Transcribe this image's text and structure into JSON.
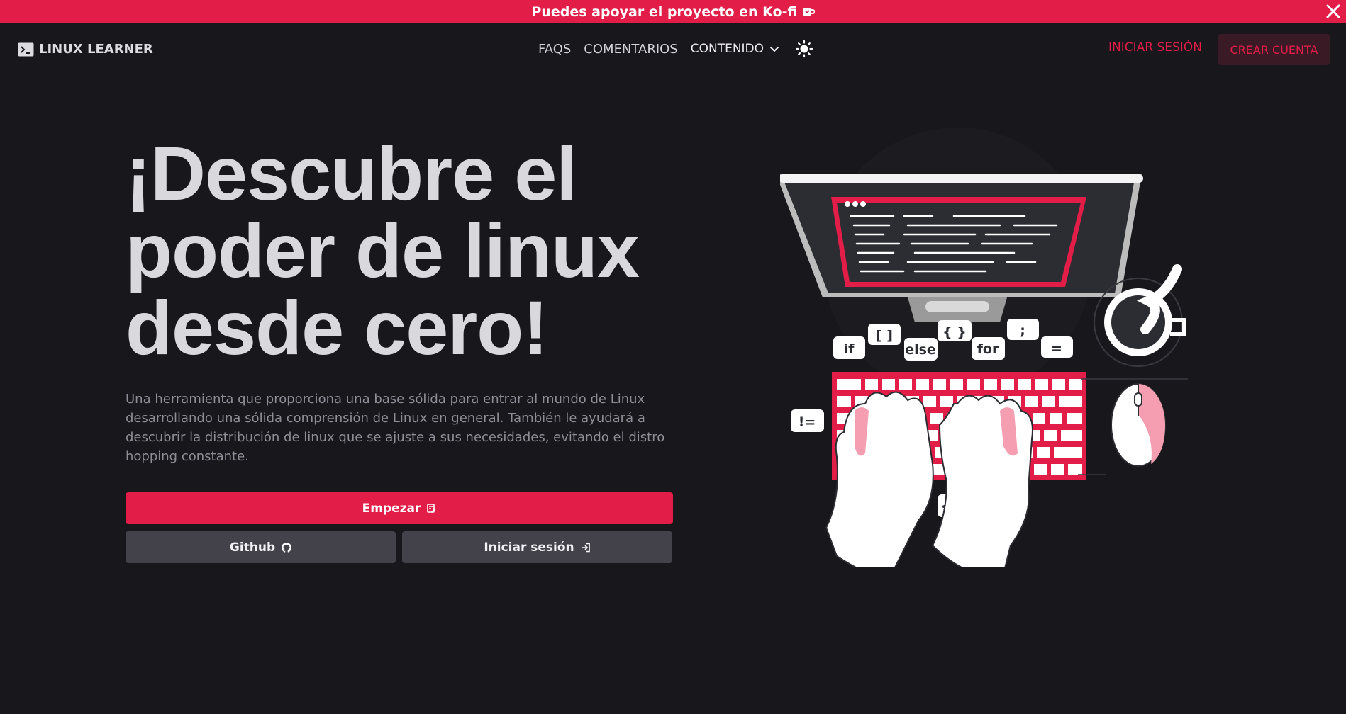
{
  "banner": {
    "text": "Puedes apoyar el proyecto en Ko-fi",
    "cup_icon": "coffee-cup-icon",
    "close_icon": "close-icon"
  },
  "navbar": {
    "brand": "LINUX LEARNER",
    "brand_icon": "terminal-icon",
    "links": [
      "FAQS",
      "COMENTARIOS"
    ],
    "dropdown_label": "CONTENIDO",
    "theme_icon": "sun-icon",
    "login": "INICIAR SESIÓN",
    "signup": "CREAR CUENTA"
  },
  "hero": {
    "title_line1": "¡Descubre el",
    "title_line2": "poder de linux",
    "title_line3": "desde cero!",
    "description": "Una herramienta que proporciona una base sólida para entrar al mundo de Linux desarrollando una sólida comprensión de Linux en general. También le ayudará a descubrir la distribución de linux que se ajuste a sus necesidades, evitando el distro hopping constante.",
    "start_button": "Empezar",
    "github_button": "Github",
    "login_button": "Iniciar sesión"
  },
  "illustration": {
    "bubbles": [
      "if",
      "[ ]",
      "else",
      "{ }",
      "for",
      ";",
      "=",
      "!=",
      "</>"
    ]
  },
  "colors": {
    "accent": "#e11d48",
    "background": "#18171c",
    "button_gray": "#43424a"
  }
}
